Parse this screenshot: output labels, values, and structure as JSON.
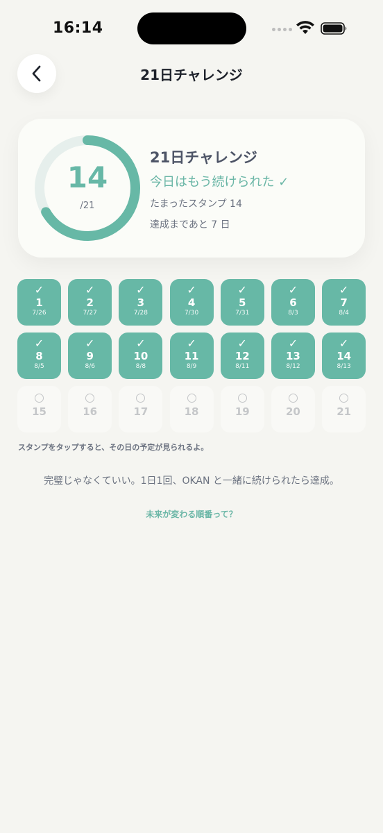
{
  "status_bar": {
    "time": "16:14"
  },
  "header": {
    "title": "21日チャレンジ"
  },
  "summary": {
    "count": "14",
    "total": "/21",
    "progress": 0.6667,
    "title": "21日チャレンジ",
    "status": "今日はもう続けられた ✓",
    "stamps_text": "たまったスタンプ 14",
    "remaining_text": "達成まであと 7 日"
  },
  "stamps": [
    {
      "day": "1",
      "date": "7/26",
      "done": true
    },
    {
      "day": "2",
      "date": "7/27",
      "done": true
    },
    {
      "day": "3",
      "date": "7/28",
      "done": true
    },
    {
      "day": "4",
      "date": "7/30",
      "done": true
    },
    {
      "day": "5",
      "date": "7/31",
      "done": true
    },
    {
      "day": "6",
      "date": "8/3",
      "done": true
    },
    {
      "day": "7",
      "date": "8/4",
      "done": true
    },
    {
      "day": "8",
      "date": "8/5",
      "done": true
    },
    {
      "day": "9",
      "date": "8/6",
      "done": true
    },
    {
      "day": "10",
      "date": "8/8",
      "done": true
    },
    {
      "day": "11",
      "date": "8/9",
      "done": true
    },
    {
      "day": "12",
      "date": "8/11",
      "done": true
    },
    {
      "day": "13",
      "date": "8/12",
      "done": true
    },
    {
      "day": "14",
      "date": "8/13",
      "done": true
    },
    {
      "day": "15",
      "date": "",
      "done": false
    },
    {
      "day": "16",
      "date": "",
      "done": false
    },
    {
      "day": "17",
      "date": "",
      "done": false
    },
    {
      "day": "18",
      "date": "",
      "done": false
    },
    {
      "day": "19",
      "date": "",
      "done": false
    },
    {
      "day": "20",
      "date": "",
      "done": false
    },
    {
      "day": "21",
      "date": "",
      "done": false
    }
  ],
  "check_mark": "✓",
  "footer": {
    "tap_hint": "スタンプをタップすると、その日の予定が見られるよ。",
    "encourage": "完璧じゃなくていい。1日1回、OKAN と一緒に続けられたら達成。",
    "future_link": "未来が変わる順番って？"
  },
  "colors": {
    "accent": "#67b8a6",
    "ring_track": "#e6efec",
    "background": "#f5f5f1"
  },
  "icons": {
    "back": "chevron-left-icon",
    "wifi": "wifi-icon",
    "battery": "battery-icon",
    "cellular": "cellular-signal-icon"
  }
}
